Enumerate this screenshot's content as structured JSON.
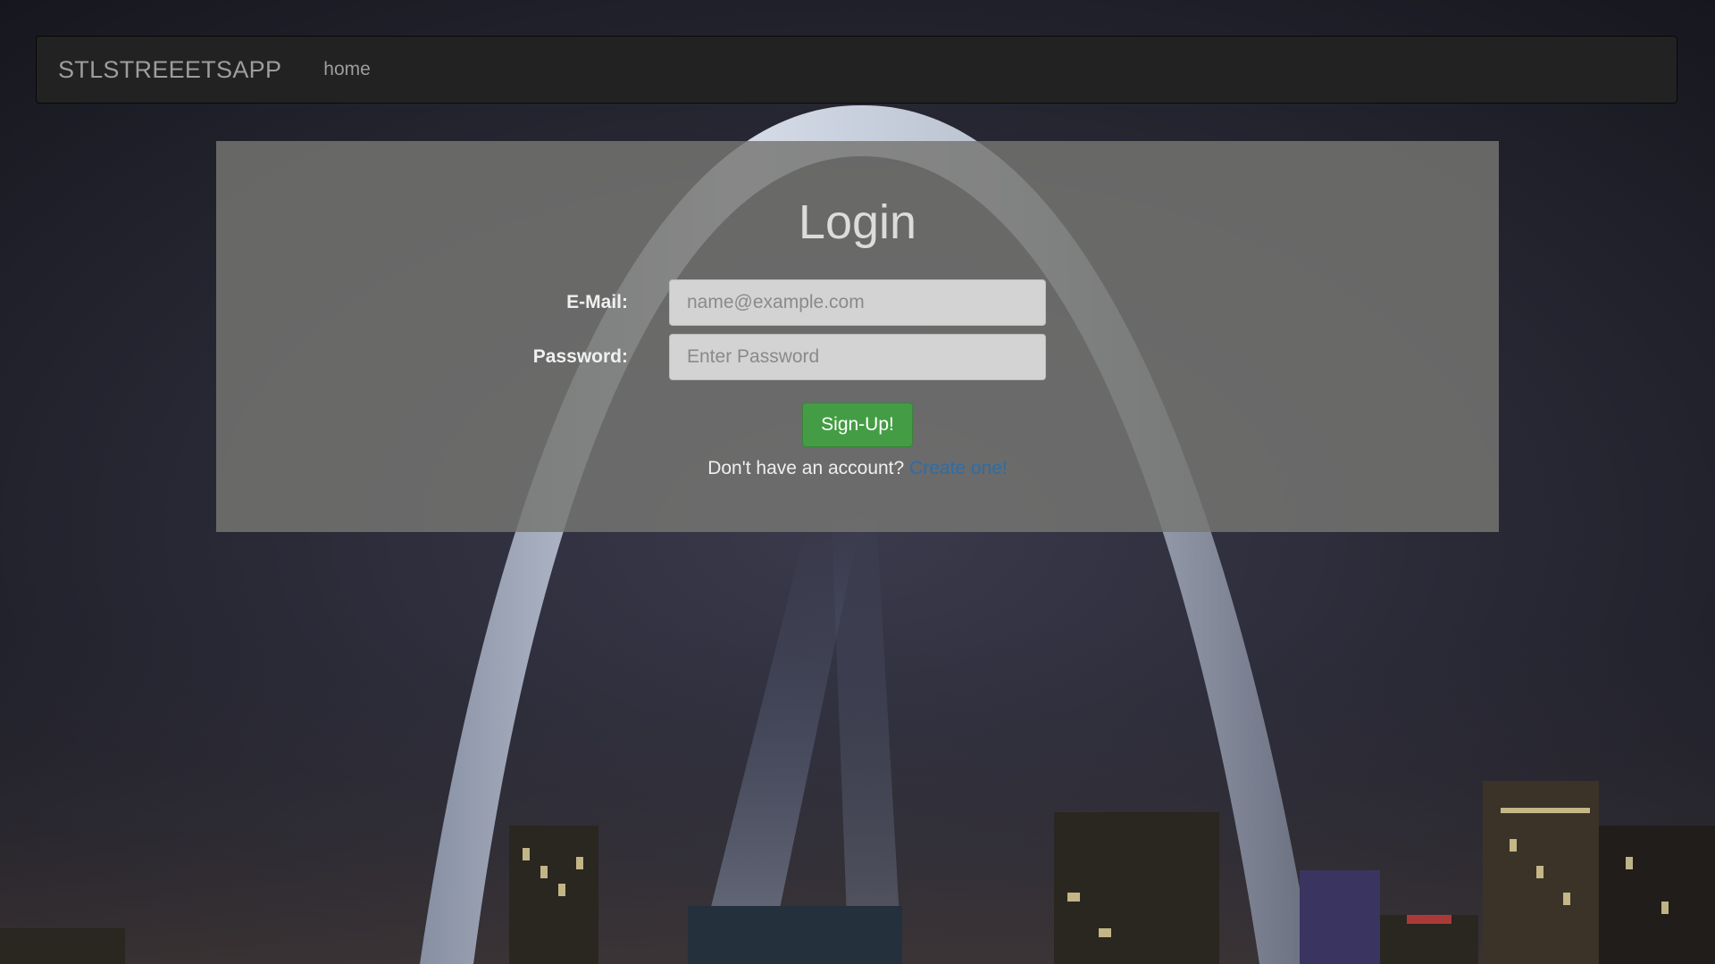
{
  "navbar": {
    "brand": "STLSTREEETSAPP",
    "links": [
      {
        "label": "home"
      }
    ]
  },
  "login": {
    "title": "Login",
    "email_label": "E-Mail:",
    "email_placeholder": "name@example.com",
    "email_value": "",
    "password_label": "Password:",
    "password_placeholder": "Enter Password",
    "password_value": "",
    "submit_label": "Sign-Up!",
    "no_account_text": "Don't have an account?",
    "create_link": "Create one!"
  },
  "colors": {
    "navbar_bg": "#222222",
    "navbar_text": "#9d9d9d",
    "panel_bg": "rgba(118,118,114,0.83)",
    "button_bg": "#449d44",
    "link": "#2e6da4"
  }
}
